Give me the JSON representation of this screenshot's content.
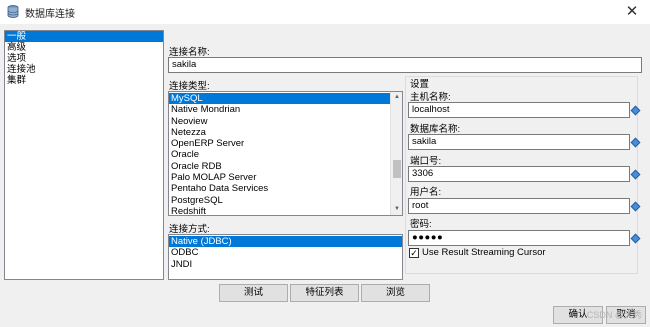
{
  "window": {
    "title": "数据库连接",
    "close_symbol": "✕",
    "icon": "database-icon"
  },
  "sidebar": {
    "items": [
      {
        "label": "一般",
        "selected": true
      },
      {
        "label": "高级",
        "selected": false
      },
      {
        "label": "选项",
        "selected": false
      },
      {
        "label": "连接池",
        "selected": false
      },
      {
        "label": "集群",
        "selected": false
      }
    ]
  },
  "form": {
    "connection_name_label": "连接名称:",
    "connection_name_value": "sakila",
    "connection_type_label": "连接类型:",
    "connection_types": [
      {
        "label": "MySQL",
        "selected": true
      },
      {
        "label": "Native Mondrian",
        "selected": false
      },
      {
        "label": "Neoview",
        "selected": false
      },
      {
        "label": "Netezza",
        "selected": false
      },
      {
        "label": "OpenERP Server",
        "selected": false
      },
      {
        "label": "Oracle",
        "selected": false
      },
      {
        "label": "Oracle RDB",
        "selected": false
      },
      {
        "label": "Palo MOLAP Server",
        "selected": false
      },
      {
        "label": "Pentaho Data Services",
        "selected": false
      },
      {
        "label": "PostgreSQL",
        "selected": false
      },
      {
        "label": "Redshift",
        "selected": false
      }
    ],
    "access_method_label": "连接方式:",
    "access_methods": [
      {
        "label": "Native (JDBC)",
        "selected": true
      },
      {
        "label": "ODBC",
        "selected": false
      },
      {
        "label": "JNDI",
        "selected": false
      }
    ]
  },
  "settings": {
    "title": "设置",
    "hostname_label": "主机名称:",
    "hostname_value": "localhost",
    "database_label": "数据库名称:",
    "database_value": "sakila",
    "port_label": "端口号:",
    "port_value": "3306",
    "username_label": "用户名:",
    "username_value": "root",
    "password_label": "密码:",
    "password_value": "●●●●●",
    "streaming_label": "Use Result Streaming Cursor",
    "streaming_checked": true,
    "check_symbol": "✓",
    "variable_icon": "diamond-variable-icon"
  },
  "buttons": {
    "test": "测试",
    "features": "特征列表",
    "explore": "浏览",
    "ok": "确认",
    "cancel": "取消"
  },
  "scroll_arrows": {
    "up": "▲",
    "down": "▼"
  },
  "watermark": "CSDN @大秀"
}
